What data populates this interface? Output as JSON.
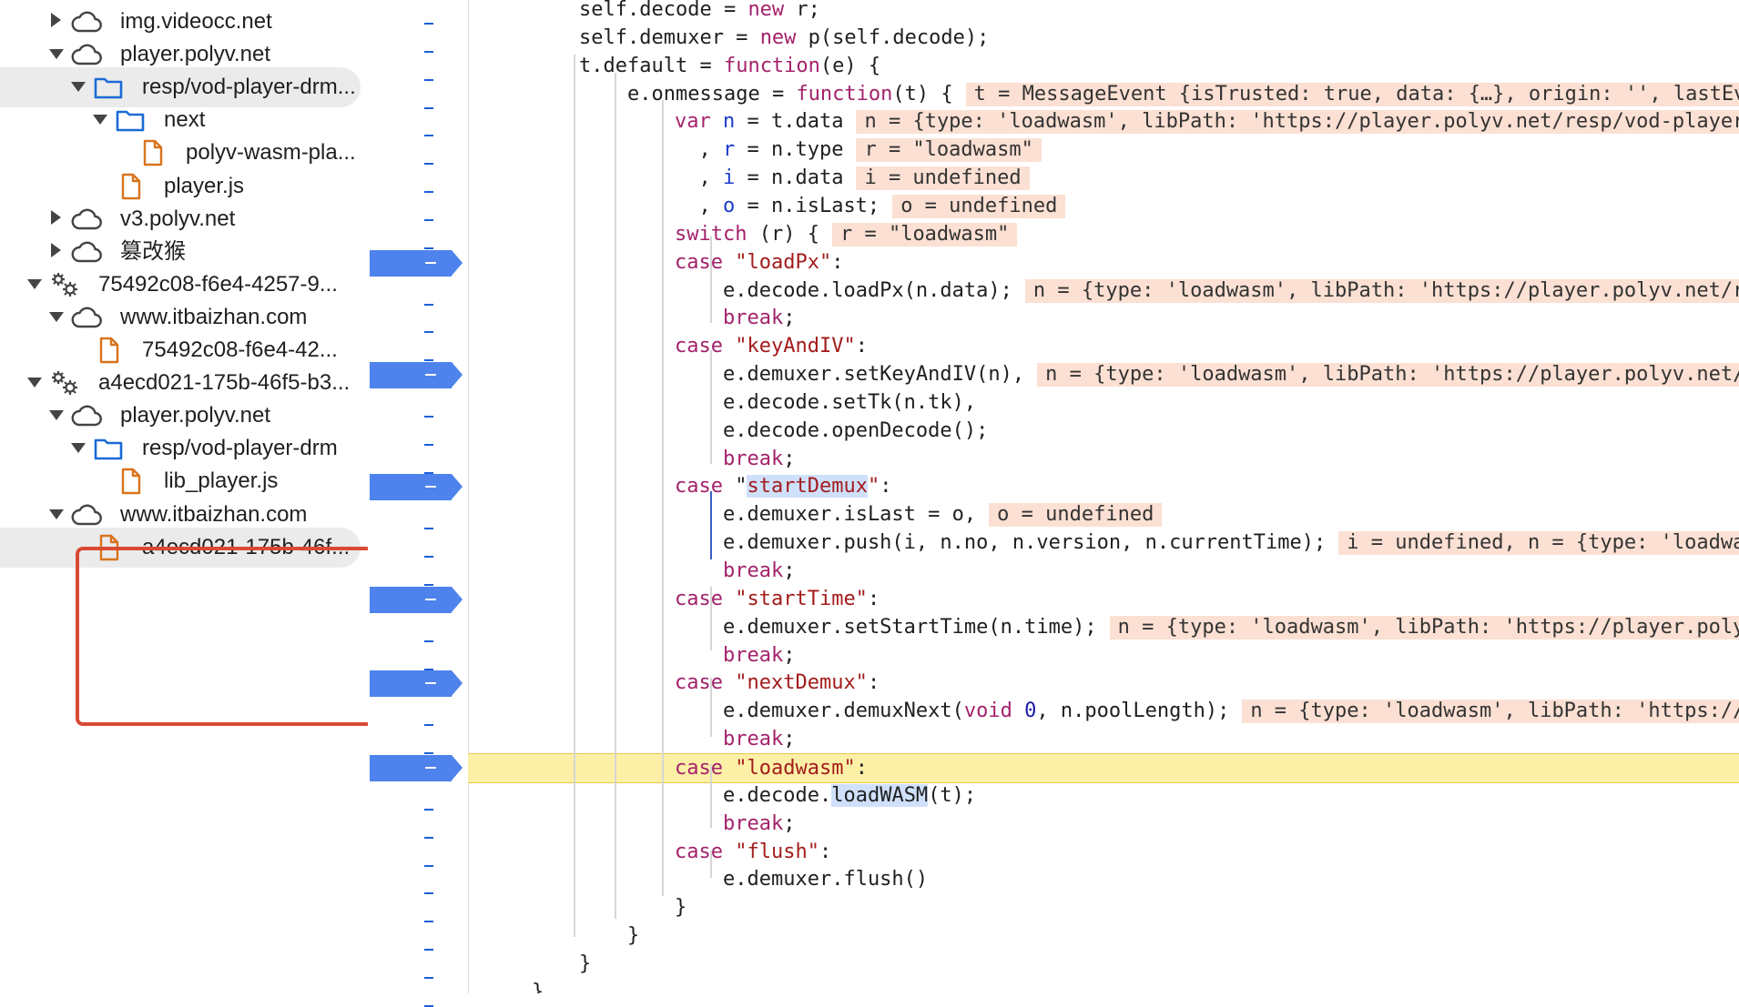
{
  "file_tree": {
    "rows": [
      {
        "label": "img.videocc.net",
        "icon": "cloud-icon",
        "arrow": "right",
        "depth": 1,
        "selected": false
      },
      {
        "label": "player.polyv.net",
        "icon": "cloud-icon",
        "arrow": "down",
        "depth": 1,
        "selected": false
      },
      {
        "label": "resp/vod-player-drm...",
        "icon": "folder-icon",
        "arrow": "down",
        "depth": 2,
        "selected": true
      },
      {
        "label": "next",
        "icon": "folder-icon",
        "arrow": "down",
        "depth": 3,
        "selected": false
      },
      {
        "label": "polyv-wasm-pla...",
        "icon": "file-icon",
        "arrow": "",
        "depth": 4,
        "selected": false
      },
      {
        "label": "player.js",
        "icon": "file-icon",
        "arrow": "",
        "depth": 3,
        "selected": false
      },
      {
        "label": "v3.polyv.net",
        "icon": "cloud-icon",
        "arrow": "right",
        "depth": 1,
        "selected": false
      },
      {
        "label": "篡改猴",
        "icon": "cloud-icon",
        "arrow": "right",
        "depth": 1,
        "selected": false
      },
      {
        "label": "75492c08-f6e4-4257-9...",
        "icon": "gears-icon",
        "arrow": "down",
        "depth": 0,
        "selected": false
      },
      {
        "label": "www.itbaizhan.com",
        "icon": "cloud-icon",
        "arrow": "down",
        "depth": 1,
        "selected": false
      },
      {
        "label": "75492c08-f6e4-42...",
        "icon": "file-icon",
        "arrow": "",
        "depth": 2,
        "selected": false
      },
      {
        "label": "a4ecd021-175b-46f5-b3...",
        "icon": "gears-icon",
        "arrow": "down",
        "depth": 0,
        "selected": false
      },
      {
        "label": "player.polyv.net",
        "icon": "cloud-icon",
        "arrow": "down",
        "depth": 1,
        "selected": false
      },
      {
        "label": "resp/vod-player-drm",
        "icon": "folder-icon",
        "arrow": "down",
        "depth": 2,
        "selected": false
      },
      {
        "label": "lib_player.js",
        "icon": "file-icon",
        "arrow": "",
        "depth": 3,
        "selected": false
      },
      {
        "label": "www.itbaizhan.com",
        "icon": "cloud-icon",
        "arrow": "down",
        "depth": 1,
        "selected": false
      },
      {
        "label": "a4ecd021-175b-46f...",
        "icon": "file-icon",
        "arrow": "",
        "depth": 2,
        "selected": true
      }
    ]
  },
  "gutter": {
    "breakpoint_lines": [
      9,
      13,
      17,
      21,
      24,
      27
    ]
  },
  "code": {
    "exec_line": 27,
    "lines": [
      {
        "indent": 4,
        "tokens": [
          [
            "",
            "self.decode = "
          ],
          [
            "kw",
            "new"
          ],
          [
            "",
            " r;"
          ]
        ],
        "inline": ""
      },
      {
        "indent": 4,
        "tokens": [
          [
            "",
            "self.demuxer = "
          ],
          [
            "kw",
            "new"
          ],
          [
            "",
            " p(self.decode);"
          ]
        ],
        "inline": ""
      },
      {
        "indent": 4,
        "tokens": [
          [
            "",
            "t.default = "
          ],
          [
            "kw",
            "function"
          ],
          [
            "",
            "(e) {"
          ]
        ],
        "inline": ""
      },
      {
        "indent": 5,
        "tokens": [
          [
            "",
            "e.onmessage = "
          ],
          [
            "kw",
            "function"
          ],
          [
            "",
            "(t) {"
          ]
        ],
        "inline": "t = MessageEvent {isTrusted: true, data: {…}, origin: '', lastEventId: '', source: null, …}"
      },
      {
        "indent": 6,
        "tokens": [
          [
            "kw",
            "var"
          ],
          [
            "",
            " "
          ],
          [
            "var",
            "n"
          ],
          [
            "",
            " = t.data"
          ]
        ],
        "inline": "n = {type: 'loadwasm', libPath: 'https://player.polyv.net/resp/vod-player-drm/canary/next/polyv-wasm-player.wasm'}"
      },
      {
        "indent": 6,
        "tokens": [
          [
            "",
            "  , "
          ],
          [
            "var",
            "r"
          ],
          [
            "",
            " = n.type"
          ]
        ],
        "inline": "r = \"loadwasm\""
      },
      {
        "indent": 6,
        "tokens": [
          [
            "",
            "  , "
          ],
          [
            "var",
            "i"
          ],
          [
            "",
            " = n.data"
          ]
        ],
        "inline": "i = undefined"
      },
      {
        "indent": 6,
        "tokens": [
          [
            "",
            "  , "
          ],
          [
            "var",
            "o"
          ],
          [
            "",
            " = n.isLast;"
          ]
        ],
        "inline": "o = undefined"
      },
      {
        "indent": 6,
        "tokens": [
          [
            "kw",
            "switch"
          ],
          [
            "",
            " (r) {"
          ]
        ],
        "inline": "r = \"loadwasm\""
      },
      {
        "indent": 7,
        "tokens": [
          [
            "",
            "e.decode.loadPx(n.data);"
          ]
        ],
        "inline": "n = {type: 'loadwasm', libPath: 'https://player.polyv.net/resp/vod-player-drm/canary/next/polyv-wasm-player.wasm'}"
      },
      {
        "indent": 7,
        "tokens": [
          [
            "kw",
            "break"
          ],
          [
            "",
            ";"
          ]
        ],
        "inline": ""
      },
      {
        "indent": 6,
        "tokens": [
          [
            "kw",
            "case"
          ],
          [
            "",
            " "
          ],
          [
            "str",
            "\"keyAndIV\""
          ],
          [
            "",
            ":"
          ]
        ],
        "inline": ""
      },
      {
        "indent": 7,
        "tokens": [
          [
            "",
            "e.demuxer.setKeyAndIV(n),"
          ]
        ],
        "inline": "n = {type: 'loadwasm', libPath: 'https://player.polyv.net/resp/vod-player-drm/canary/next/polyv-wasm-player.wasm'}"
      },
      {
        "indent": 7,
        "tokens": [
          [
            "",
            "e.decode.setTk(n.tk),"
          ]
        ],
        "inline": ""
      },
      {
        "indent": 7,
        "tokens": [
          [
            "",
            "e.decode.openDecode();"
          ]
        ],
        "inline": ""
      },
      {
        "indent": 7,
        "tokens": [
          [
            "kw",
            "break"
          ],
          [
            "",
            ";"
          ]
        ],
        "inline": ""
      },
      {
        "indent": 6,
        "tokens": [
          [
            "kw",
            "case"
          ],
          [
            "",
            " \""
          ],
          [
            "hlstr",
            "startDemux"
          ],
          [
            "str",
            "\""
          ],
          [
            "",
            ":"
          ]
        ],
        "inline": ""
      },
      {
        "indent": 7,
        "tokens": [
          [
            "",
            "e.demuxer.isLast = o,"
          ]
        ],
        "inline": "o = undefined"
      },
      {
        "indent": 7,
        "tokens": [
          [
            "",
            "e.demuxer.push(i, n.no, n.version, n.currentTime);"
          ]
        ],
        "inline": "i = undefined, n = {type: 'loadwasm', libPath: 'https://player.polyv.net/resp/vod-player-drm/canary/next/polyv-wasm-player.wasm'}"
      },
      {
        "indent": 7,
        "tokens": [
          [
            "kw",
            "break"
          ],
          [
            "",
            ";"
          ]
        ],
        "inline": ""
      },
      {
        "indent": 6,
        "tokens": [
          [
            "kw",
            "case"
          ],
          [
            "",
            " "
          ],
          [
            "str",
            "\"startTime\""
          ],
          [
            "",
            ":"
          ]
        ],
        "inline": ""
      },
      {
        "indent": 7,
        "tokens": [
          [
            "",
            "e.demuxer.setStartTime(n.time);"
          ]
        ],
        "inline": "n = {type: 'loadwasm', libPath: 'https://player.polyv.net/resp/vod-player-drm/canary/next/polyv-wasm-player.wasm'}"
      },
      {
        "indent": 7,
        "tokens": [
          [
            "kw",
            "break"
          ],
          [
            "",
            ";"
          ]
        ],
        "inline": ""
      },
      {
        "indent": 6,
        "tokens": [
          [
            "kw",
            "case"
          ],
          [
            "",
            " "
          ],
          [
            "str",
            "\"nextDemux\""
          ],
          [
            "",
            ":"
          ]
        ],
        "inline": ""
      },
      {
        "indent": 7,
        "tokens": [
          [
            "",
            "e.demuxer.demuxNext("
          ],
          [
            "kw",
            "void"
          ],
          [
            "",
            " "
          ],
          [
            "num",
            "0"
          ],
          [
            "",
            ", n.poolLength);"
          ]
        ],
        "inline": "n = {type: 'loadwasm', libPath: 'https://player.polyv.net/resp/vod-player-drm/canary/next/polyv-wasm-player.wasm'}"
      },
      {
        "indent": 7,
        "tokens": [
          [
            "kw",
            "break"
          ],
          [
            "",
            ";"
          ]
        ],
        "inline": ""
      },
      {
        "indent": 6,
        "tokens": [
          [
            "kw",
            "case"
          ],
          [
            "",
            " "
          ],
          [
            "str",
            "\"loadwasm\""
          ],
          [
            "",
            ":"
          ]
        ],
        "inline": ""
      },
      {
        "indent": 7,
        "tokens": [
          [
            "",
            "e.decode."
          ],
          [
            "hl",
            "loadWASM"
          ],
          [
            "",
            "(t);"
          ]
        ],
        "inline": ""
      },
      {
        "indent": 7,
        "tokens": [
          [
            "kw",
            "break"
          ],
          [
            "",
            ";"
          ]
        ],
        "inline": ""
      },
      {
        "indent": 6,
        "tokens": [
          [
            "kw",
            "case"
          ],
          [
            "",
            " "
          ],
          [
            "str",
            "\"flush\""
          ],
          [
            "",
            ":"
          ]
        ],
        "inline": ""
      },
      {
        "indent": 7,
        "tokens": [
          [
            "",
            "e.demuxer.flush()"
          ]
        ],
        "inline": ""
      },
      {
        "indent": 6,
        "tokens": [
          [
            "",
            "}"
          ]
        ],
        "inline": ""
      },
      {
        "indent": 5,
        "tokens": [
          [
            "",
            "}"
          ]
        ],
        "inline": ""
      },
      {
        "indent": 4,
        "tokens": [
          [
            "",
            "}"
          ]
        ],
        "inline": ""
      },
      {
        "indent": 3,
        "tokens": [
          [
            "",
            "},"
          ]
        ],
        "inline": ""
      }
    ]
  },
  "case_lines": {
    "loadPx": {
      "tokens": [
        [
          "kw",
          "case"
        ],
        [
          "",
          " "
        ],
        [
          "str",
          "\"loadPx\""
        ],
        [
          "",
          ":"
        ]
      ]
    }
  },
  "colors": {
    "breakpoint": "#4e82ec",
    "exec_line": "#fcf0a7",
    "inline_value_bg": "#fbe0d3",
    "keyword": "#a3226b",
    "string": "#a31c1c",
    "annotation_box": "#d94a33"
  }
}
